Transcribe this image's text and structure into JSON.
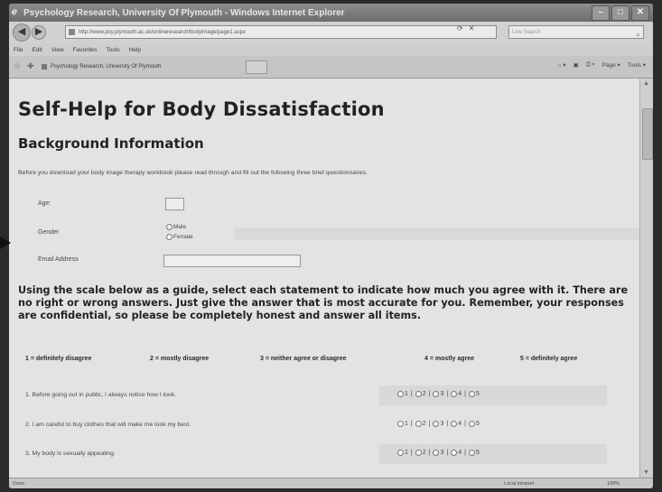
{
  "window": {
    "title": "Psychology Research, University Of Plymouth - Windows Internet Explorer"
  },
  "browser": {
    "url": "http://www.psy.plymouth.ac.uk/onlineresearch/bodyimage/page1.aspx",
    "search_placeholder": "Live Search",
    "menu": [
      "File",
      "Edit",
      "View",
      "Favorites",
      "Tools",
      "Help"
    ],
    "tab_title": "Psychology Research, University Of Plymouth",
    "commands": [
      "Page ▾",
      "Tools ▾"
    ],
    "status_done": "Done",
    "status_zone": "Local intranet",
    "status_zoom": "100%"
  },
  "page": {
    "title": "Self-Help for Body Dissatisfaction",
    "section": "Background Information",
    "intro": "Before you download your body image therapy workbook please read through and fill out the following three brief questionnaires.",
    "form": {
      "age_label": "Age:",
      "gender_label": "Gender",
      "gender_options": [
        "Male",
        "Female"
      ],
      "email_label": "Email Address"
    },
    "instructions": "Using the scale below as a guide, select each statement to indicate how much you agree with it. There are no right or wrong answers. Just give the answer that is most accurate for you. Remember, your responses are confidential, so please be completely honest and answer all items.",
    "scale": [
      "1 = definitely disagree",
      "2 = mostly disagree",
      "3 = neither agree or disagree",
      "4 = mostly agree",
      "5 = definitely agree"
    ],
    "questions": [
      "1. Before going out in public, I always notice how I look.",
      "2. I am careful to buy clothes that will make me look my best.",
      "3. My body is sexually appealing."
    ],
    "answer_options": [
      "1",
      "2",
      "3",
      "4",
      "5"
    ]
  },
  "colors": {
    "page_bg": "#ececec",
    "titlebar": "#6b6b6b"
  }
}
